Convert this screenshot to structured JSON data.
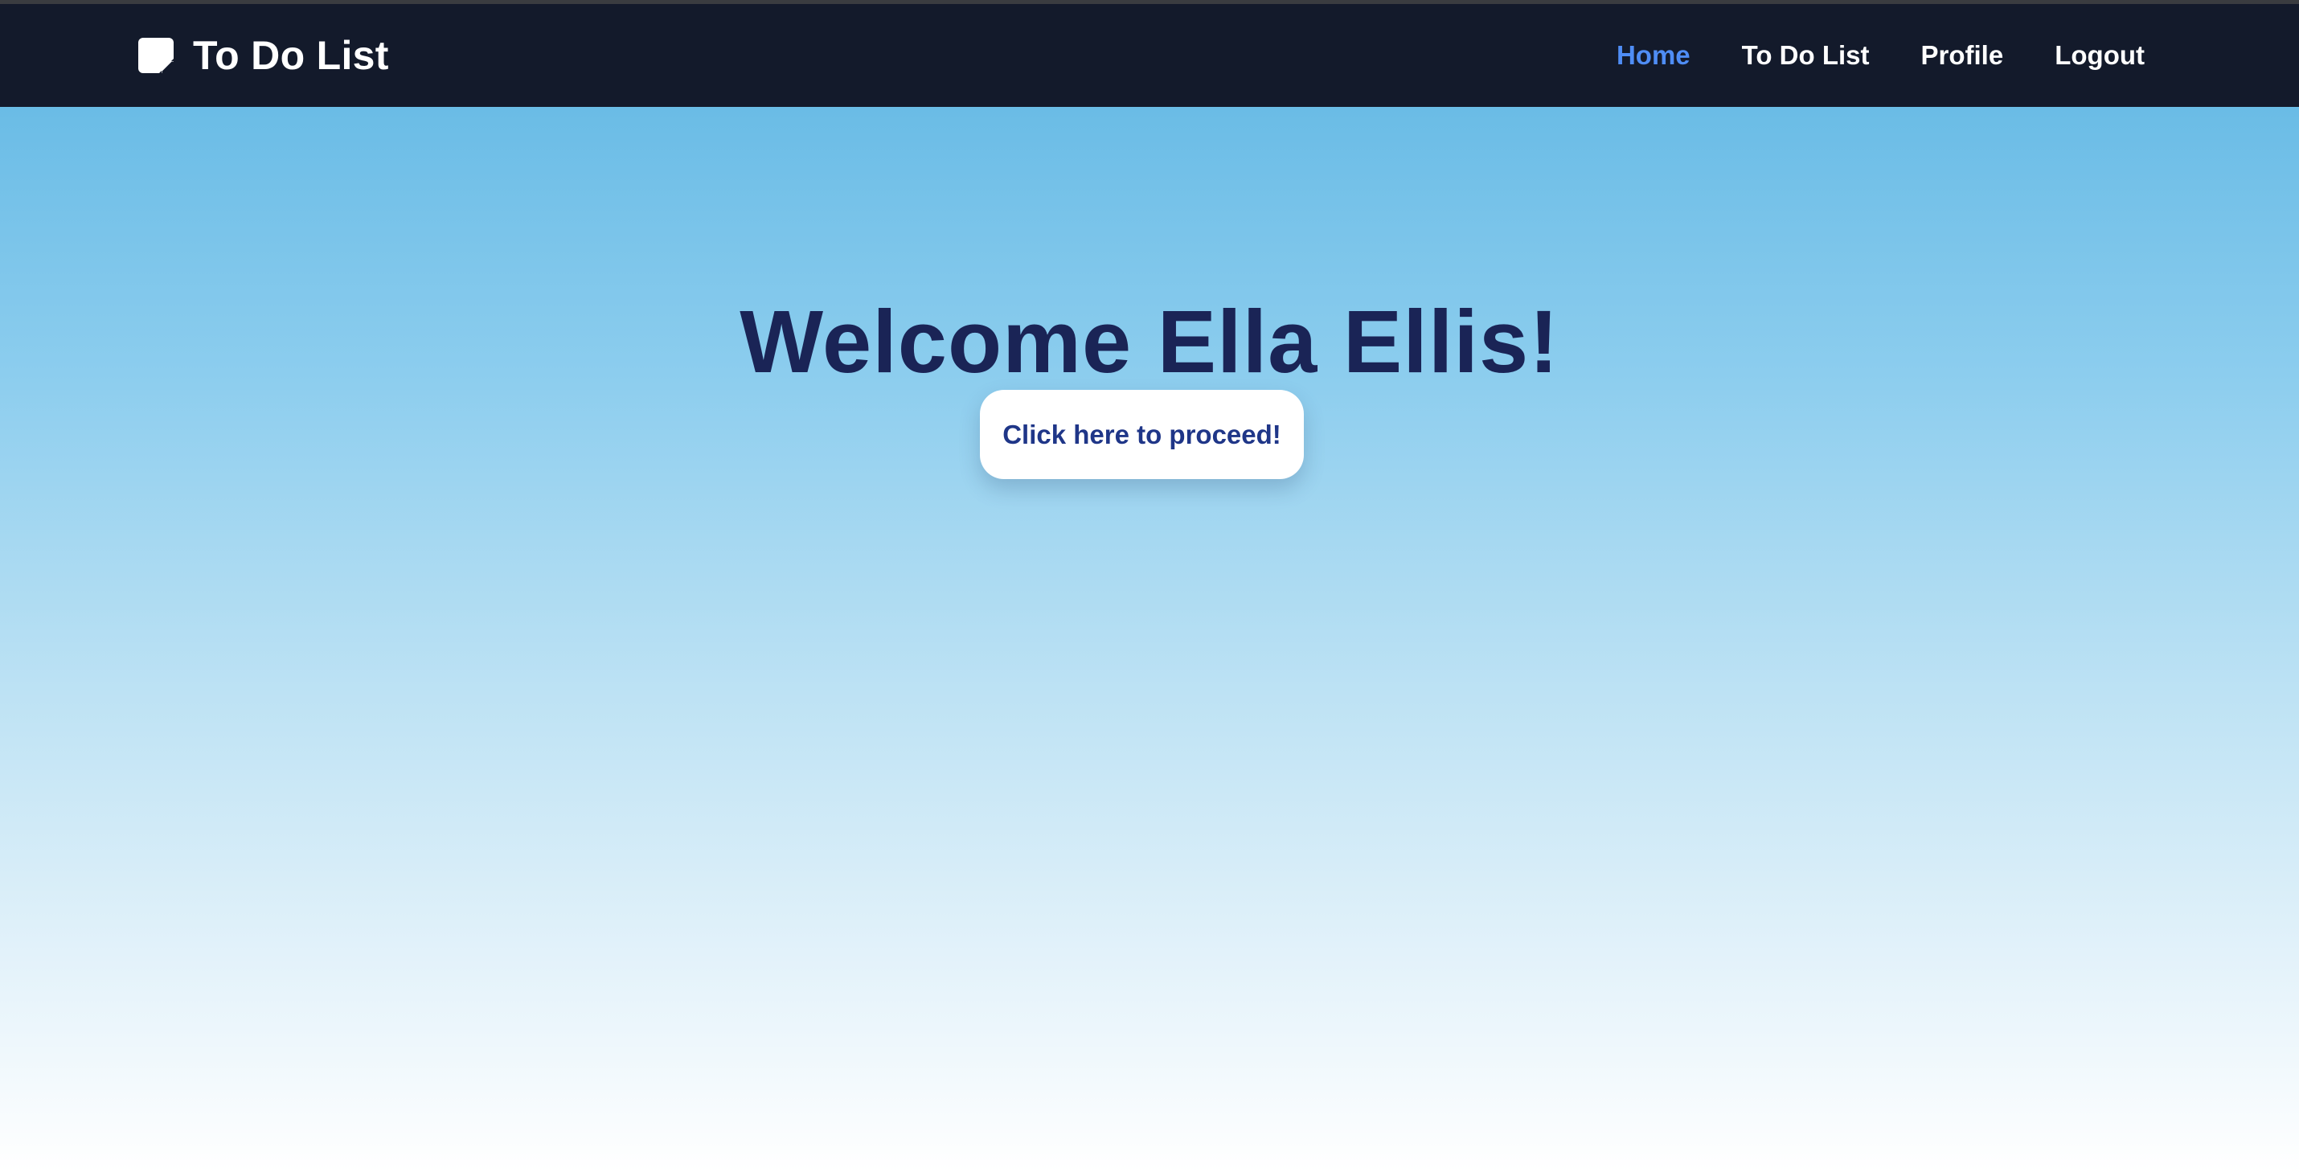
{
  "navbar": {
    "brand_icon": "sticky-note-icon",
    "brand_title": "To Do List",
    "links": [
      {
        "label": "Home",
        "active": true
      },
      {
        "label": "To Do List",
        "active": false
      },
      {
        "label": "Profile",
        "active": false
      },
      {
        "label": "Logout",
        "active": false
      }
    ],
    "active_color": "#4f8df5",
    "background_color": "#131a2b"
  },
  "hero": {
    "welcome_text": "Welcome Ella Ellis!",
    "proceed_button_label": "Click here to proceed!",
    "gradient_top_color": "#6abce6",
    "gradient_bottom_color": "#ffffff"
  }
}
